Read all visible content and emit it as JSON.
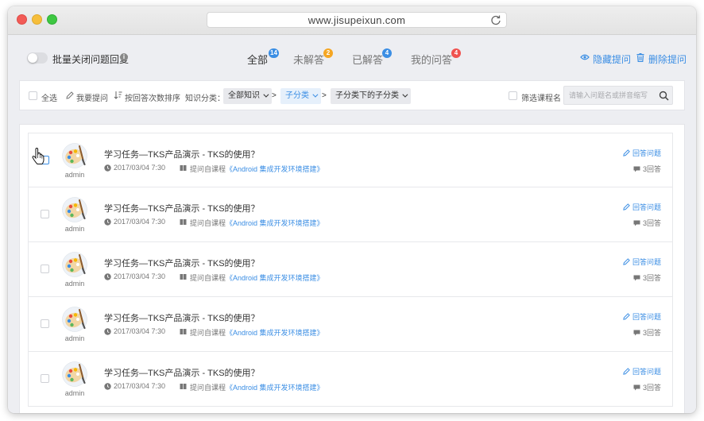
{
  "browser": {
    "url": "www.jisupeixun.com"
  },
  "toolbar": {
    "batch_toggle_label": "批量关闭问题回复",
    "tabs": [
      {
        "label": "全部",
        "badge": "14",
        "badge_color": "#3b8ee4"
      },
      {
        "label": "未解答",
        "badge": "2",
        "badge_color": "#f5a623"
      },
      {
        "label": "已解答",
        "badge": "4",
        "badge_color": "#3b8ee4"
      },
      {
        "label": "我的问答",
        "badge": "4",
        "badge_color": "#f0524f"
      }
    ],
    "hide_label": "隐藏提问",
    "delete_label": "删除提问"
  },
  "filters": {
    "select_all": "全选",
    "my_questions": "我要提问",
    "sort_label": "按回答次数排序",
    "category_label": "知识分类：",
    "category_all": "全部知识",
    "subcategory": "子分类",
    "sub_subcategory": "子分类下的子分类",
    "arrow": ">",
    "filter_course": "筛选课程名",
    "search_placeholder": "请输入问题名或拼音缩写"
  },
  "questions": [
    {
      "author": "admin",
      "title": "学习任务—TKS产品演示 - TKS的使用？",
      "date": "2017/03/04 7:30",
      "source_prefix": "提问自课程",
      "course": "《Android 集成开发环境搭建》",
      "answer_label": "回答问题",
      "answer_count": "3回答"
    },
    {
      "author": "admin",
      "title": "学习任务—TKS产品演示 - TKS的使用？",
      "date": "2017/03/04 7:30",
      "source_prefix": "提问自课程",
      "course": "《Android 集成开发环境搭建》",
      "answer_label": "回答问题",
      "answer_count": "3回答"
    },
    {
      "author": "admin",
      "title": "学习任务—TKS产品演示 - TKS的使用？",
      "date": "2017/03/04 7:30",
      "source_prefix": "提问自课程",
      "course": "《Android 集成开发环境搭建》",
      "answer_label": "回答问题",
      "answer_count": "3回答"
    },
    {
      "author": "admin",
      "title": "学习任务—TKS产品演示 - TKS的使用？",
      "date": "2017/03/04 7:30",
      "source_prefix": "提问自课程",
      "course": "《Android 集成开发环境搭建》",
      "answer_label": "回答问题",
      "answer_count": "3回答"
    },
    {
      "author": "admin",
      "title": "学习任务—TKS产品演示 - TKS的使用？",
      "date": "2017/03/04 7:30",
      "source_prefix": "提问自课程",
      "course": "《Android 集成开发环境搭建》",
      "answer_label": "回答问题",
      "answer_count": "3回答"
    }
  ],
  "colors": {
    "accent": "#3b8ee4",
    "page_bg": "#edeef2"
  }
}
